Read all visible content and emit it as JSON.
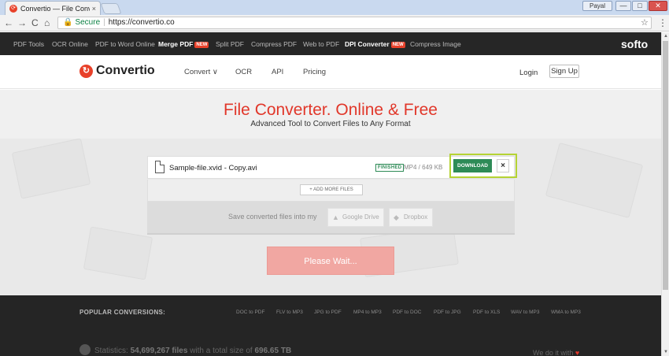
{
  "browser": {
    "tab_title": "Convertio — File Conve",
    "tab_close": "×",
    "user_badge": "Payal",
    "win_min": "—",
    "win_max": "□",
    "win_close": "✕",
    "back": "←",
    "forward": "→",
    "reload": "C",
    "home": "⌂",
    "secure_label": "Secure",
    "url": "https://convertio.co",
    "star": "☆",
    "menu": "⋮"
  },
  "productbar": {
    "items": [
      {
        "label": "PDF Tools"
      },
      {
        "label": "OCR Online"
      },
      {
        "label": "PDF to Word Online"
      },
      {
        "label": "Merge PDF",
        "badge": "NEW"
      },
      {
        "label": "Split PDF"
      },
      {
        "label": "Compress PDF"
      },
      {
        "label": "Web to PDF"
      },
      {
        "label": "DPI Converter",
        "badge": "NEW"
      },
      {
        "label": "Compress Image"
      }
    ],
    "brand": "softo"
  },
  "header": {
    "logo_text": "Convertio",
    "nav": [
      {
        "label": "Convert ∨"
      },
      {
        "label": "OCR"
      },
      {
        "label": "API"
      },
      {
        "label": "Pricing"
      }
    ],
    "login": "Login",
    "signup": "Sign Up"
  },
  "hero": {
    "title": "File Converter. Online & Free",
    "subtitle": "Advanced Tool to Convert Files to Any Format"
  },
  "file": {
    "name": "Sample-file.xvid - Copy.avi",
    "status": "FINISHED",
    "meta": "MP4 / 649 KB",
    "download": "DOWNLOAD",
    "remove": "×"
  },
  "add_more": "+ ADD MORE FILES",
  "save": {
    "label": "Save converted files into my",
    "google_drive": "Google Drive",
    "dropbox": "Dropbox"
  },
  "wait_button": "Please Wait...",
  "footer": {
    "popular_label": "POPULAR CONVERSIONS:",
    "popular": [
      "DOC to PDF",
      "FLV to MP3",
      "JPG to PDF",
      "MP4 to MP3",
      "PDF to DOC",
      "PDF to JPG",
      "PDF to XLS",
      "WAV to MP3",
      "WMA to MP3"
    ],
    "stats_prefix": "Statistics:",
    "stats_files": "54,699,267 files",
    "stats_mid": "with a total size of",
    "stats_size": "696.65 TB",
    "doit": "We do it with",
    "heart": "♥"
  },
  "scrollbar": {
    "up": "▲",
    "down": "▼"
  }
}
